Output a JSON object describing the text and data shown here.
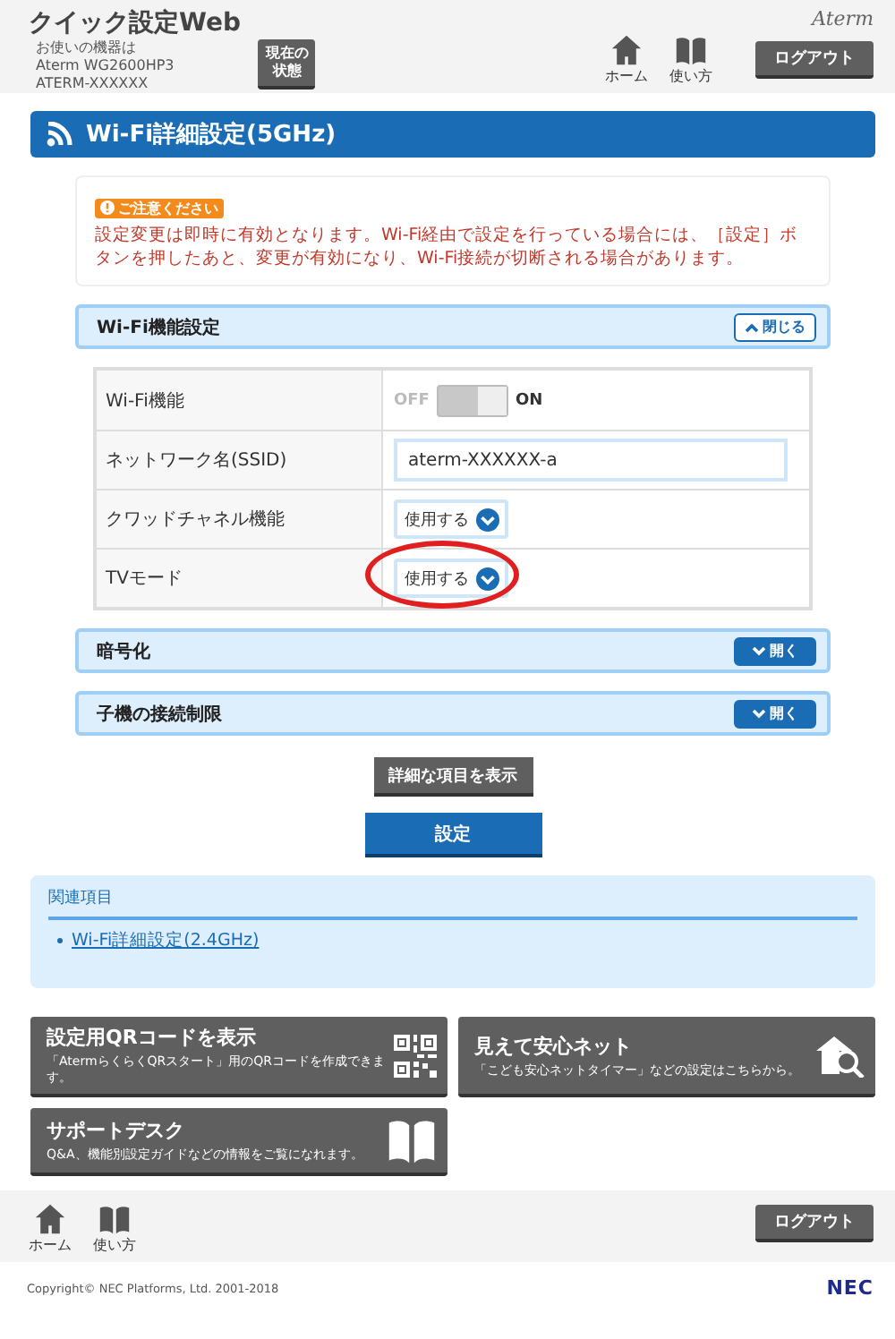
{
  "header": {
    "title": "クイック設定Web",
    "device_lines": [
      "お使いの機器は",
      "Aterm WG2600HP3",
      "ATERM-XXXXXX"
    ],
    "status_button": "現在の状態",
    "brand": "Aterm",
    "nav": [
      {
        "kind": "home",
        "label": "ホーム"
      },
      {
        "kind": "book",
        "label": "使い方"
      }
    ],
    "logout": "ログアウト"
  },
  "page_title": "Wi-Fi詳細設定(5GHz)",
  "notice": {
    "badge": "ご注意ください",
    "text": "設定変更は即時に有効となります。Wi-Fi経由で設定を行っている場合には、［設定］ボタンを押したあと、変更が有効になり、Wi-Fi接続が切断される場合があります。"
  },
  "sections": [
    {
      "title": "Wi-Fi機能設定",
      "expanded": true,
      "toggle_label": "閉じる",
      "rows": [
        {
          "label": "Wi-Fi機能",
          "kind": "switch",
          "off_label": "OFF",
          "on_label": "ON",
          "on": true,
          "highlighted": false
        },
        {
          "label": "ネットワーク名(SSID)",
          "kind": "text",
          "value": "aterm-XXXXXX-a",
          "highlighted": false
        },
        {
          "label": "クワッドチャネル機能",
          "kind": "select",
          "value": "使用する",
          "highlighted": false
        },
        {
          "label": "TVモード",
          "kind": "select",
          "value": "使用する",
          "highlighted": true
        }
      ]
    },
    {
      "title": "暗号化",
      "expanded": false,
      "toggle_label": "開く"
    },
    {
      "title": "子機の接続制限",
      "expanded": false,
      "toggle_label": "開く"
    }
  ],
  "detail_button": "詳細な項目を表示",
  "submit_button": "設定",
  "related": {
    "title": "関連項目",
    "links": [
      "Wi-Fi詳細設定(2.4GHz)"
    ]
  },
  "tiles": [
    {
      "kind": "qr",
      "title": "設定用QRコードを表示",
      "description": "「AtermらくらくQRスタート」用のQRコードを作成できます。"
    },
    {
      "kind": "house-search",
      "title": "見えて安心ネット",
      "description": "「こども安心ネットタイマー」などの設定はこちらから。"
    },
    {
      "kind": "book",
      "title": "サポートデスク",
      "description": "Q&A、機能別設定ガイドなどの情報をご覧になれます。"
    }
  ],
  "footer": {
    "nav": [
      {
        "kind": "home",
        "label": "ホーム"
      },
      {
        "kind": "book",
        "label": "使い方"
      }
    ],
    "logout": "ログアウト",
    "copyright": "Copyright© NEC Platforms, Ltd. 2001-2018",
    "brand": "NEC"
  }
}
